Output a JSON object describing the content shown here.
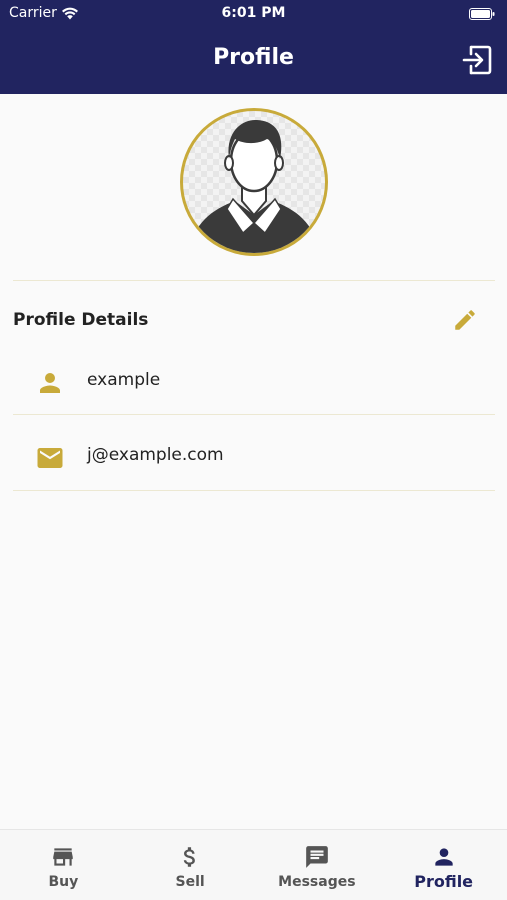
{
  "status_bar": {
    "carrier": "Carrier",
    "time": "6:01 PM"
  },
  "header": {
    "title": "Profile"
  },
  "profile": {
    "section_title": "Profile Details",
    "username": "example",
    "email": "j@example.com"
  },
  "bottom_nav": {
    "items": [
      {
        "label": "Buy",
        "icon": "store-icon"
      },
      {
        "label": "Sell",
        "icon": "dollar-icon"
      },
      {
        "label": "Messages",
        "icon": "message-icon"
      },
      {
        "label": "Profile",
        "icon": "person-icon",
        "active": true
      }
    ]
  },
  "colors": {
    "header_bg": "#212460",
    "accent_gold": "#c8aa3a",
    "nav_active": "#212460",
    "nav_inactive": "#555555"
  }
}
